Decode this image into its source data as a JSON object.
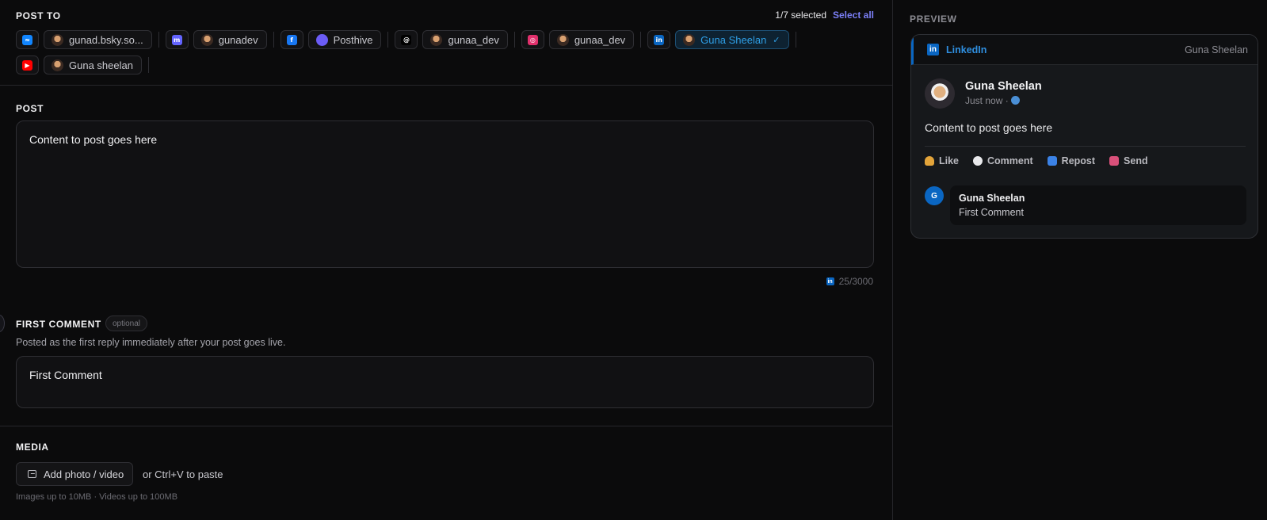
{
  "post_to": {
    "title": "POST TO",
    "selected_count": "1/7 selected",
    "select_all": "Select all",
    "row1": [
      {
        "type": "platform",
        "icon": "bluesky-icon",
        "color": "#1185fe",
        "glyph": "≈"
      },
      {
        "type": "account",
        "label": "gunad.bsky.so..."
      },
      {
        "type": "sep"
      },
      {
        "type": "platform",
        "icon": "mastodon-icon",
        "color": "#6364ff",
        "glyph": "m"
      },
      {
        "type": "account",
        "label": "gunadev"
      },
      {
        "type": "sep"
      },
      {
        "type": "platform",
        "icon": "facebook-icon",
        "color": "#1877f2",
        "glyph": "f"
      },
      {
        "type": "account",
        "label": "Posthive",
        "avatar_color": "#6b5cf6"
      },
      {
        "type": "sep"
      },
      {
        "type": "platform",
        "icon": "threads-icon",
        "color": "#000000",
        "glyph": "@"
      },
      {
        "type": "account",
        "label": "gunaa_dev"
      },
      {
        "type": "sep"
      },
      {
        "type": "platform",
        "icon": "instagram-icon",
        "color": "#e1306c",
        "glyph": "◎"
      },
      {
        "type": "account",
        "label": "gunaa_dev"
      },
      {
        "type": "sep"
      },
      {
        "type": "platform",
        "icon": "linkedin-icon",
        "color": "#0a66c2",
        "glyph": "in"
      },
      {
        "type": "account",
        "label": "Guna Sheelan",
        "active": true,
        "check": "✓"
      },
      {
        "type": "sep"
      }
    ],
    "row2": [
      {
        "type": "platform",
        "icon": "youtube-icon",
        "color": "#ff0000",
        "glyph": "▶"
      },
      {
        "type": "account",
        "label": "Guna sheelan"
      },
      {
        "type": "sep"
      }
    ]
  },
  "post": {
    "label": "POST",
    "content": "Content to post goes here",
    "counter": "25/3000"
  },
  "first_comment": {
    "label": "FIRST COMMENT",
    "optional": "optional",
    "description": "Posted as the first reply immediately after your post goes live.",
    "content": "First Comment"
  },
  "media": {
    "label": "MEDIA",
    "add_button": "Add photo / video",
    "paste_hint": "or Ctrl+V to paste",
    "limits": "Images up to 10MB · Videos up to 100MB"
  },
  "preview": {
    "title": "PREVIEW",
    "network": "LinkedIn",
    "account": "Guna Sheelan",
    "user": "Guna Sheelan",
    "time": "Just now ·",
    "text": "Content to post goes here",
    "actions": [
      {
        "label": "Like",
        "icon": "like-icon",
        "cls": "like"
      },
      {
        "label": "Comment",
        "icon": "comment-icon",
        "cls": "comment"
      },
      {
        "label": "Repost",
        "icon": "repost-icon",
        "cls": "repost"
      },
      {
        "label": "Send",
        "icon": "send-icon",
        "cls": "send"
      }
    ],
    "comment": {
      "initial": "G",
      "name": "Guna Sheelan",
      "text": "First Comment"
    }
  },
  "colors": {
    "accent": "#7b7ff7",
    "linkedin": "#0a66c2"
  }
}
